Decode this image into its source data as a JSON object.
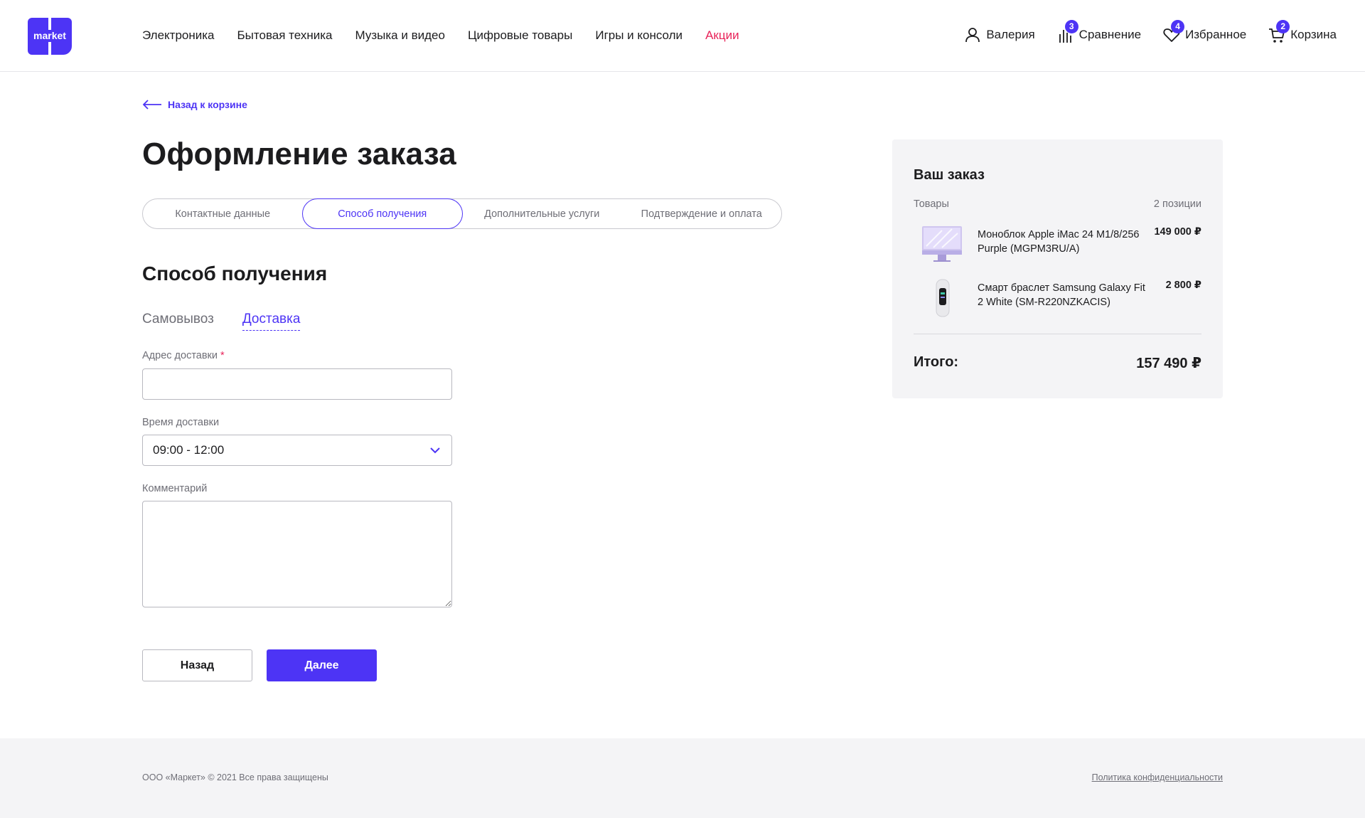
{
  "brand": {
    "logo_text": "market",
    "accent": "#4d34f5",
    "promo_color": "#e8245a"
  },
  "nav": {
    "items": [
      {
        "label": "Электроника"
      },
      {
        "label": "Бытовая техника"
      },
      {
        "label": "Музыка и видео"
      },
      {
        "label": "Цифровые товары"
      },
      {
        "label": "Игры и консоли"
      },
      {
        "label": "Акции"
      }
    ]
  },
  "user_nav": {
    "profile": {
      "label": "Валерия",
      "icon": "user-icon"
    },
    "compare": {
      "label": "Сравнение",
      "count": "3",
      "icon": "compare-icon"
    },
    "favorites": {
      "label": "Избранное",
      "count": "4",
      "icon": "heart-icon"
    },
    "cart": {
      "label": "Корзина",
      "count": "2",
      "icon": "cart-icon"
    }
  },
  "back_link": {
    "label": "Назад к корзине"
  },
  "page_title": "Оформление заказа",
  "steps": [
    {
      "label": "Контактные данные"
    },
    {
      "label": "Способ получения",
      "active": true
    },
    {
      "label": "Дополнительные услуги"
    },
    {
      "label": "Подтверждение и оплата"
    }
  ],
  "section_title": "Способ получения",
  "method_tabs": [
    {
      "label": "Самовывоз"
    },
    {
      "label": "Доставка",
      "active": true
    }
  ],
  "form": {
    "address": {
      "label": "Адрес доставки",
      "required_mark": "*",
      "value": ""
    },
    "time": {
      "label": "Время доставки",
      "value": "09:00 - 12:00"
    },
    "comment": {
      "label": "Комментарий",
      "value": ""
    }
  },
  "buttons": {
    "back": "Назад",
    "next": "Далее"
  },
  "summary": {
    "title": "Ваш заказ",
    "items_label": "Товары",
    "items_count": "2 позиции",
    "items": [
      {
        "name": "Моноблок Apple iMac 24 M1/8/256 Purple (MGPM3RU/A)",
        "price": "149 000 ₽",
        "icon": "imac-thumbnail"
      },
      {
        "name": "Смарт браслет Samsung Galaxy Fit 2 White (SM-R220NZKACIS)",
        "price": "2 800 ₽",
        "icon": "fitness-band-thumbnail"
      }
    ],
    "total_label": "Итого:",
    "total_value": "157 490 ₽"
  },
  "footer": {
    "copyright": "ООО «Маркет» © 2021 Все права защищены",
    "policy": "Политика конфиденциальности"
  }
}
